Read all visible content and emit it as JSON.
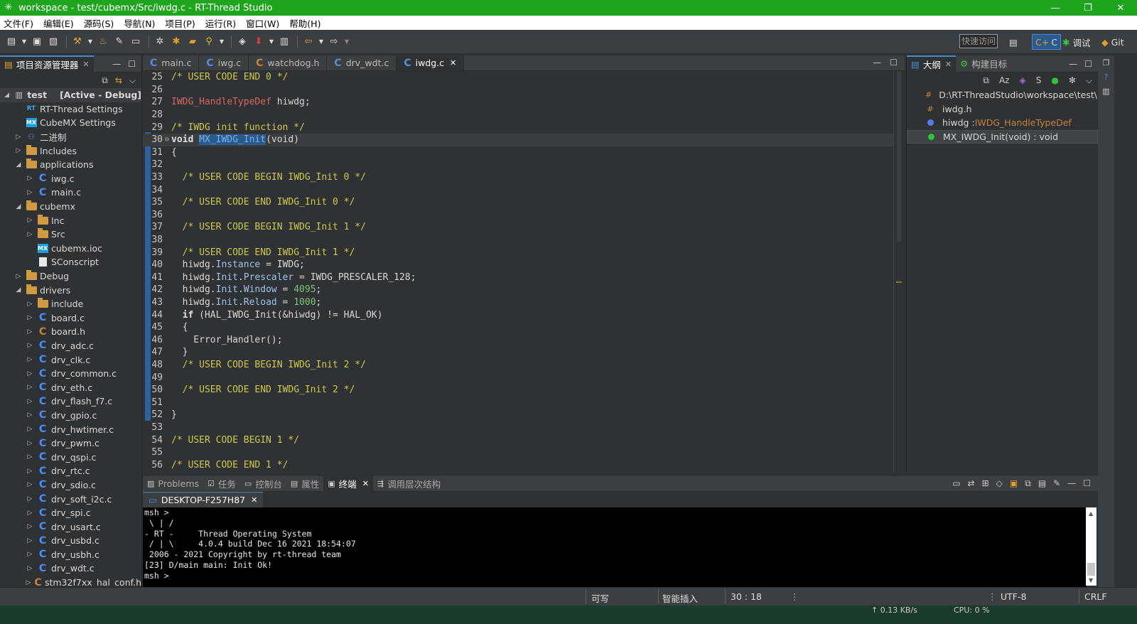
{
  "window": {
    "title": "workspace - test/cubemx/Src/iwdg.c - RT-Thread Studio",
    "minimize": "—",
    "maximize": "❐",
    "close": "✕"
  },
  "menu": [
    "文件(F)",
    "编辑(E)",
    "源码(S)",
    "导航(N)",
    "项目(P)",
    "运行(R)",
    "窗口(W)",
    "帮助(H)"
  ],
  "toolbar": {
    "quick_access": "快速访问",
    "perspective_c": "C",
    "perspective_debug": "调试",
    "perspective_git": "Git"
  },
  "project_explorer": {
    "title": "项目资源管理器",
    "items": [
      {
        "label": "test",
        "suffix": "[Active - Debug]",
        "depth": 0,
        "arrow": "down",
        "icon": "project"
      },
      {
        "label": "RT-Thread Settings",
        "depth": 1,
        "arrow": "",
        "icon": "rt"
      },
      {
        "label": "CubeMX Settings",
        "depth": 1,
        "arrow": "",
        "icon": "mx"
      },
      {
        "label": "二进制",
        "depth": 1,
        "arrow": "right",
        "icon": "binary"
      },
      {
        "label": "Includes",
        "depth": 1,
        "arrow": "right",
        "icon": "includes"
      },
      {
        "label": "applications",
        "depth": 1,
        "arrow": "down",
        "icon": "folder"
      },
      {
        "label": "iwg.c",
        "depth": 2,
        "arrow": "right",
        "icon": "c"
      },
      {
        "label": "main.c",
        "depth": 2,
        "arrow": "right",
        "icon": "c"
      },
      {
        "label": "cubemx",
        "depth": 1,
        "arrow": "down",
        "icon": "folder"
      },
      {
        "label": "Inc",
        "depth": 2,
        "arrow": "right",
        "icon": "folder"
      },
      {
        "label": "Src",
        "depth": 2,
        "arrow": "right",
        "icon": "folder"
      },
      {
        "label": "cubemx.ioc",
        "depth": 2,
        "arrow": "",
        "icon": "mx"
      },
      {
        "label": "SConscript",
        "depth": 2,
        "arrow": "",
        "icon": "file"
      },
      {
        "label": "Debug",
        "depth": 1,
        "arrow": "right",
        "icon": "folder"
      },
      {
        "label": "drivers",
        "depth": 1,
        "arrow": "down",
        "icon": "folder"
      },
      {
        "label": "include",
        "depth": 2,
        "arrow": "right",
        "icon": "folder"
      },
      {
        "label": "board.c",
        "depth": 2,
        "arrow": "right",
        "icon": "c"
      },
      {
        "label": "board.h",
        "depth": 2,
        "arrow": "right",
        "icon": "h"
      },
      {
        "label": "drv_adc.c",
        "depth": 2,
        "arrow": "right",
        "icon": "c"
      },
      {
        "label": "drv_clk.c",
        "depth": 2,
        "arrow": "right",
        "icon": "c"
      },
      {
        "label": "drv_common.c",
        "depth": 2,
        "arrow": "right",
        "icon": "c"
      },
      {
        "label": "drv_eth.c",
        "depth": 2,
        "arrow": "right",
        "icon": "c"
      },
      {
        "label": "drv_flash_f7.c",
        "depth": 2,
        "arrow": "right",
        "icon": "c"
      },
      {
        "label": "drv_gpio.c",
        "depth": 2,
        "arrow": "right",
        "icon": "c"
      },
      {
        "label": "drv_hwtimer.c",
        "depth": 2,
        "arrow": "right",
        "icon": "c"
      },
      {
        "label": "drv_pwm.c",
        "depth": 2,
        "arrow": "right",
        "icon": "c"
      },
      {
        "label": "drv_qspi.c",
        "depth": 2,
        "arrow": "right",
        "icon": "c"
      },
      {
        "label": "drv_rtc.c",
        "depth": 2,
        "arrow": "right",
        "icon": "c"
      },
      {
        "label": "drv_sdio.c",
        "depth": 2,
        "arrow": "right",
        "icon": "c"
      },
      {
        "label": "drv_soft_i2c.c",
        "depth": 2,
        "arrow": "right",
        "icon": "c"
      },
      {
        "label": "drv_spi.c",
        "depth": 2,
        "arrow": "right",
        "icon": "c"
      },
      {
        "label": "drv_usart.c",
        "depth": 2,
        "arrow": "right",
        "icon": "c"
      },
      {
        "label": "drv_usbd.c",
        "depth": 2,
        "arrow": "right",
        "icon": "c"
      },
      {
        "label": "drv_usbh.c",
        "depth": 2,
        "arrow": "right",
        "icon": "c"
      },
      {
        "label": "drv_wdt.c",
        "depth": 2,
        "arrow": "right",
        "icon": "c"
      },
      {
        "label": "stm32f7xx_hal_conf.h",
        "depth": 2,
        "arrow": "right",
        "icon": "h"
      }
    ]
  },
  "editor_tabs": [
    {
      "label": "main.c",
      "icon": "c",
      "active": false
    },
    {
      "label": "iwg.c",
      "icon": "c",
      "active": false
    },
    {
      "label": "watchdog.h",
      "icon": "h",
      "active": false
    },
    {
      "label": "drv_wdt.c",
      "icon": "c",
      "active": false
    },
    {
      "label": "iwdg.c",
      "icon": "c",
      "active": true
    }
  ],
  "code": {
    "current_line": 30,
    "lines": [
      {
        "n": 25,
        "t": [
          [
            "cm",
            "/* USER CODE END 0 */"
          ]
        ]
      },
      {
        "n": 26,
        "t": []
      },
      {
        "n": 27,
        "t": [
          [
            "ty",
            "IWDG_HandleTypeDef"
          ],
          [
            "ct",
            " hiwdg;"
          ]
        ]
      },
      {
        "n": 28,
        "t": []
      },
      {
        "n": 29,
        "t": [
          [
            "cm",
            "/* IWDG init function */"
          ]
        ]
      },
      {
        "n": 30,
        "t": [
          [
            "kw",
            "void"
          ],
          [
            "ct",
            " "
          ],
          [
            "sel",
            "MX_IWDG_Init"
          ],
          [
            "ct",
            "(void)"
          ]
        ]
      },
      {
        "n": 31,
        "t": [
          [
            "ct",
            "{"
          ]
        ]
      },
      {
        "n": 32,
        "t": []
      },
      {
        "n": 33,
        "t": [
          [
            "ct",
            "  "
          ],
          [
            "cm",
            "/* USER CODE BEGIN IWDG_Init 0 */"
          ]
        ]
      },
      {
        "n": 34,
        "t": []
      },
      {
        "n": 35,
        "t": [
          [
            "ct",
            "  "
          ],
          [
            "cm",
            "/* USER CODE END IWDG_Init 0 */"
          ]
        ]
      },
      {
        "n": 36,
        "t": []
      },
      {
        "n": 37,
        "t": [
          [
            "ct",
            "  "
          ],
          [
            "cm",
            "/* USER CODE BEGIN IWDG_Init 1 */"
          ]
        ]
      },
      {
        "n": 38,
        "t": []
      },
      {
        "n": 39,
        "t": [
          [
            "ct",
            "  "
          ],
          [
            "cm",
            "/* USER CODE END IWDG_Init 1 */"
          ]
        ]
      },
      {
        "n": 40,
        "t": [
          [
            "ct",
            "  hiwdg."
          ],
          [
            "fld",
            "Instance"
          ],
          [
            "ct",
            " = IWDG;"
          ]
        ]
      },
      {
        "n": 41,
        "t": [
          [
            "ct",
            "  hiwdg."
          ],
          [
            "fld",
            "Init"
          ],
          [
            "ct",
            "."
          ],
          [
            "fld",
            "Prescaler"
          ],
          [
            "ct",
            " = IWDG_PRESCALER_128;"
          ]
        ]
      },
      {
        "n": 42,
        "t": [
          [
            "ct",
            "  hiwdg."
          ],
          [
            "fld",
            "Init"
          ],
          [
            "ct",
            "."
          ],
          [
            "fld",
            "Window"
          ],
          [
            "ct",
            " = "
          ],
          [
            "nm",
            "4095"
          ],
          [
            "ct",
            ";"
          ]
        ]
      },
      {
        "n": 43,
        "t": [
          [
            "ct",
            "  hiwdg."
          ],
          [
            "fld",
            "Init"
          ],
          [
            "ct",
            "."
          ],
          [
            "fld",
            "Reload"
          ],
          [
            "ct",
            " = "
          ],
          [
            "nm",
            "1000"
          ],
          [
            "ct",
            ";"
          ]
        ]
      },
      {
        "n": 44,
        "t": [
          [
            "ct",
            "  "
          ],
          [
            "kw",
            "if"
          ],
          [
            "ct",
            " (HAL_IWDG_Init(&hiwdg) != HAL_OK)"
          ]
        ]
      },
      {
        "n": 45,
        "t": [
          [
            "ct",
            "  {"
          ]
        ]
      },
      {
        "n": 46,
        "t": [
          [
            "ct",
            "    Error_Handler();"
          ]
        ]
      },
      {
        "n": 47,
        "t": [
          [
            "ct",
            "  }"
          ]
        ]
      },
      {
        "n": 48,
        "t": [
          [
            "ct",
            "  "
          ],
          [
            "cm",
            "/* USER CODE BEGIN IWDG_Init 2 */"
          ]
        ]
      },
      {
        "n": 49,
        "t": []
      },
      {
        "n": 50,
        "t": [
          [
            "ct",
            "  "
          ],
          [
            "cm",
            "/* USER CODE END IWDG_Init 2 */"
          ]
        ]
      },
      {
        "n": 51,
        "t": []
      },
      {
        "n": 52,
        "t": [
          [
            "ct",
            "}"
          ]
        ]
      },
      {
        "n": 53,
        "t": []
      },
      {
        "n": 54,
        "t": [
          [
            "cm",
            "/* USER CODE BEGIN 1 */"
          ]
        ]
      },
      {
        "n": 55,
        "t": []
      },
      {
        "n": 56,
        "t": [
          [
            "cm",
            "/* USER CODE END 1 */"
          ]
        ]
      }
    ]
  },
  "outline": {
    "tabs": [
      {
        "label": "大纲",
        "active": true
      },
      {
        "label": "构建目标",
        "active": false
      }
    ],
    "items": [
      {
        "icon": "#",
        "label": "D:\\RT-ThreadStudio\\workspace\\test\\rt",
        "type": "",
        "color": "#c8813a"
      },
      {
        "icon": "#",
        "label": "iwdg.h",
        "type": "",
        "color": "#c8813a"
      },
      {
        "icon": "dot",
        "label": "hiwdg : ",
        "type": "IWDG_HandleTypeDef",
        "color": "#5a7ae8"
      },
      {
        "icon": "dot-green",
        "label": "MX_IWDG_Init(void) : void",
        "type": "",
        "color": "#2ec43a"
      }
    ]
  },
  "bottom_tabs": [
    {
      "label": "Problems",
      "active": false
    },
    {
      "label": "任务",
      "active": false
    },
    {
      "label": "控制台",
      "active": false
    },
    {
      "label": "属性",
      "active": false
    },
    {
      "label": "终端",
      "active": true
    },
    {
      "label": "调用层次结构",
      "active": false
    }
  ],
  "terminal": {
    "tab": "DESKTOP-F257H87",
    "lines": [
      "msh >",
      " \\ | /",
      "- RT -     Thread Operating System",
      " / | \\     4.0.4 build Dec 16 2021 18:54:07",
      " 2006 - 2021 Copyright by rt-thread team",
      "[23] D/main main: Init Ok!",
      "msh >"
    ]
  },
  "status": {
    "writable": "可写",
    "insert_mode": "智能插入",
    "position": "30 : 18",
    "encoding": "UTF-8",
    "line_ending": "CRLF"
  },
  "taskbar": {
    "net": "↑ 0.13 KB/s",
    "cpu": "CPU: 0 %"
  }
}
